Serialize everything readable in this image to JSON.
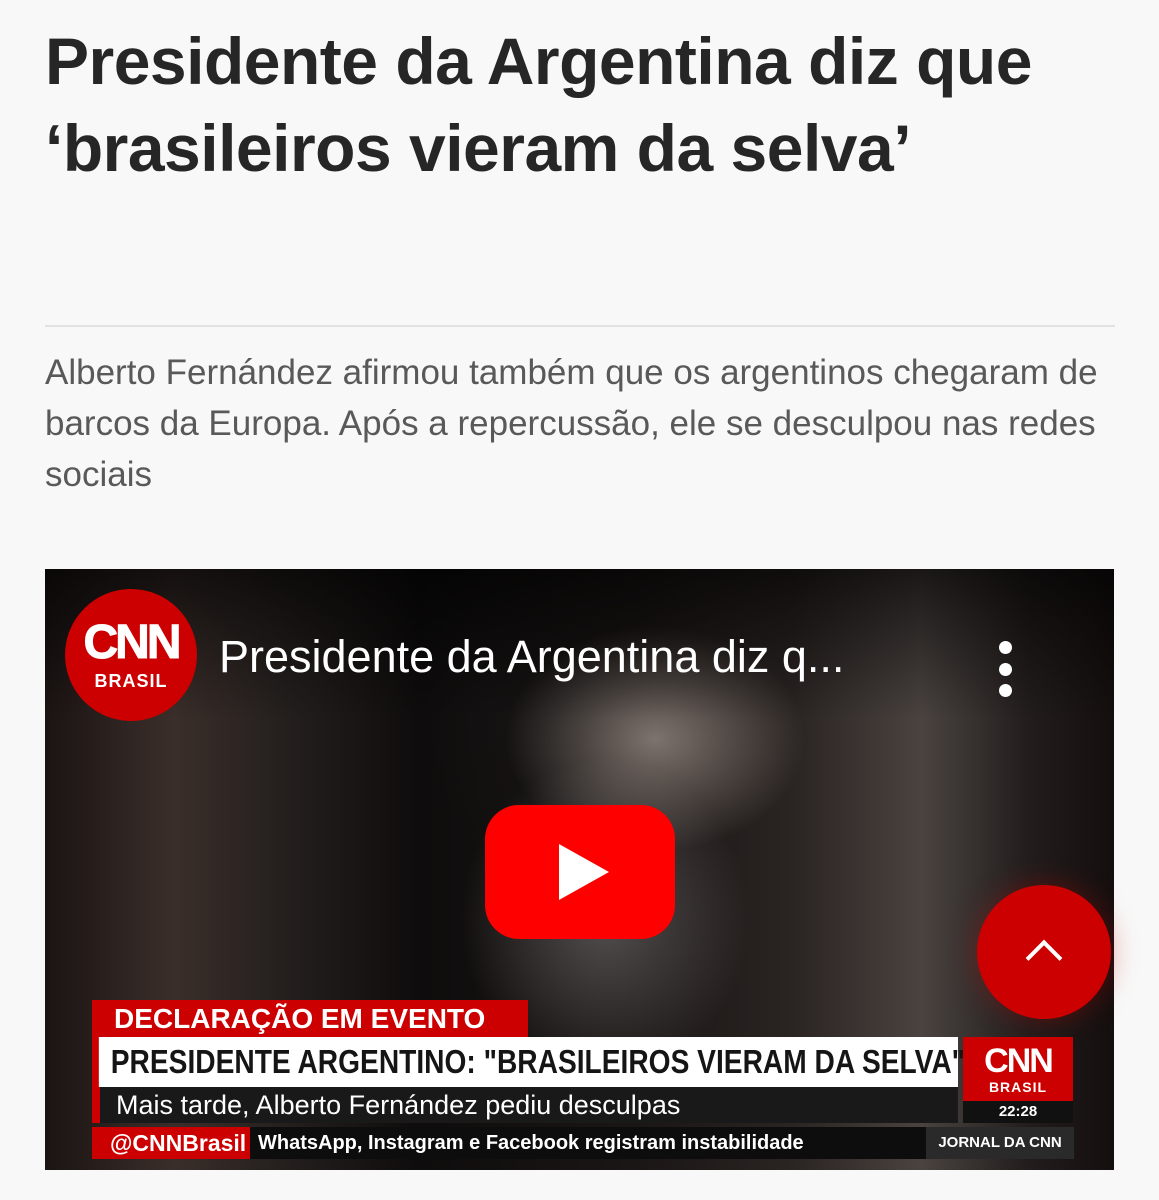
{
  "article": {
    "headline": "Presidente da Argentina diz que ‘brasileiros vieram da selva’",
    "deck": "Alberto Fernández afirmou também que os argentinos chegaram de barcos da Europa. Após a repercussão, ele se desculpou nas redes sociais"
  },
  "video": {
    "channel_logo": "CNN",
    "channel_logo_sub": "BRASIL",
    "title": "Presidente da Argentina diz q...",
    "more_icon": "vertical-ellipsis",
    "play_icon": "youtube-play",
    "overlay": {
      "kicker": "DECLARAÇÃO EM EVENTO",
      "title": "PRESIDENTE ARGENTINO: \"BRASILEIROS VIERAM DA SELVA\"",
      "subtitle": "Mais tarde, Alberto Fernández pediu desculpas",
      "corner_logo": "CNN",
      "corner_logo_sub": "BRASIL",
      "time": "22:28",
      "ticker_handle": "@CNNBrasil",
      "ticker_text": "WhatsApp, Instagram e Facebook registram instabilidade",
      "show_name": "JORNAL DA CNN"
    }
  },
  "scroll_top": {
    "icon": "chevron-up"
  },
  "colors": {
    "accent": "#cc0000",
    "youtube_red": "#ff0000",
    "background": "#f8f8f8",
    "headline": "#262626",
    "deck": "#595959"
  }
}
